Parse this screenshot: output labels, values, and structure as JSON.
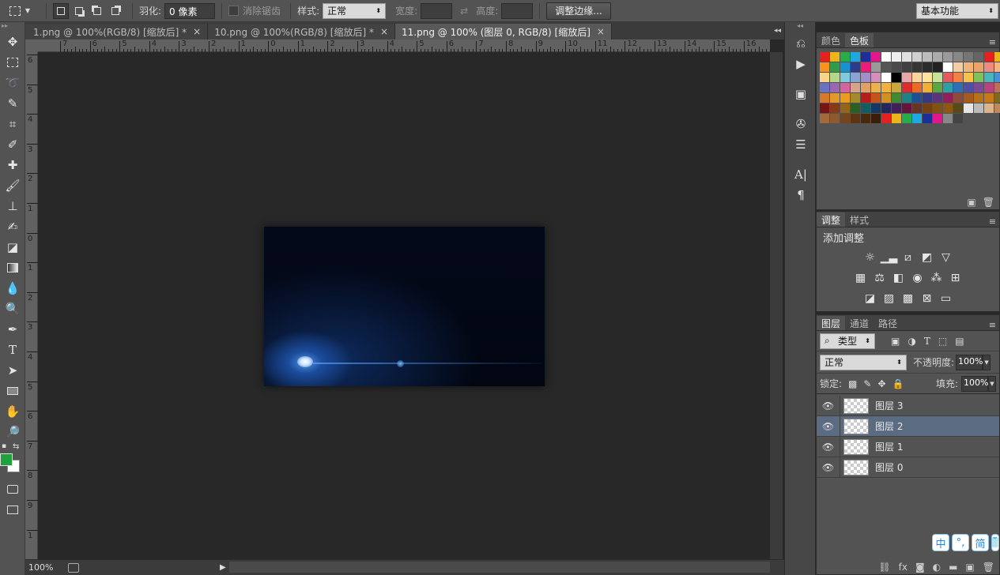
{
  "options_bar": {
    "feather_label": "羽化:",
    "feather_value": "0 像素",
    "antialias_label": "消除锯齿",
    "style_label": "样式:",
    "style_value": "正常",
    "width_label": "宽度:",
    "height_label": "高度:",
    "refine_edge_label": "调整边缘...",
    "workspace_value": "基本功能"
  },
  "tabs": [
    {
      "label": "1.png @ 100%(RGB/8) [缩放后] *"
    },
    {
      "label": "10.png @ 100%(RGB/8) [缩放后] *"
    },
    {
      "label": "11.png @ 100% (图层 0, RGB/8) [缩放后]"
    }
  ],
  "ruler": {
    "h_labels": [
      "7",
      "6",
      "5",
      "4",
      "3",
      "2",
      "1",
      "0",
      "1",
      "2",
      "3",
      "4",
      "5",
      "6",
      "7",
      "8",
      "9",
      "10",
      "11",
      "12",
      "13",
      "14",
      "15",
      "16"
    ],
    "v_labels": [
      "6",
      "5",
      "4",
      "3",
      "2",
      "1",
      "0",
      "1",
      "2",
      "3",
      "4",
      "5",
      "6",
      "7",
      "8",
      "9",
      "1",
      "0"
    ]
  },
  "status": {
    "zoom": "100%"
  },
  "swatches_panel": {
    "tabs": [
      "颜色",
      "色板"
    ],
    "colors": [
      "#e6201f",
      "#ebb51c",
      "#27ad47",
      "#1fa7e1",
      "#1c2f96",
      "#e4168c",
      "#ffffff",
      "#efefef",
      "#e0e0e0",
      "#cfcfcf",
      "#bdbdbd",
      "#ababab",
      "#9a9a9a",
      "#888888",
      "#767676",
      "#656565",
      "#e6201f",
      "#ebb51c",
      "#f7941d",
      "#2e9d4a",
      "#1891d1",
      "#2d3b8c",
      "#ed1c7a",
      "#9a9a9a",
      "#555555",
      "#4a4a4a",
      "#404040",
      "#363636",
      "#2c2c2c",
      "#222222",
      "#ffffff",
      "#f4cda4",
      "#efb47c",
      "#e8a368",
      "#ef8b7e",
      "#f6b482",
      "#fbd48a",
      "#b5d78c",
      "#7fcadb",
      "#8ba2d6",
      "#a18fc7",
      "#d38fb8",
      "#ffffff",
      "#000000",
      "#e9a6a6",
      "#ffd39b",
      "#ffe29b",
      "#c7e29b",
      "#e45b5b",
      "#f08246",
      "#f6c24c",
      "#7fc25d",
      "#4bb6b8",
      "#4b8fd4",
      "#6a72c3",
      "#9c67b2",
      "#d563a0",
      "#d9a28a",
      "#e3a064",
      "#e9b24c",
      "#f3b13b",
      "#c8a93c",
      "#dd2c2c",
      "#ea6a26",
      "#f0b033",
      "#5aa744",
      "#2ea0a4",
      "#2f6fb9",
      "#4e51a3",
      "#7b4a97",
      "#b9427e",
      "#bc6f57",
      "#d5792d",
      "#e1982c",
      "#eb9b20",
      "#a48a2c",
      "#b71c1c",
      "#c5531a",
      "#d1901f",
      "#3f8a33",
      "#1d8286",
      "#1d5193",
      "#353985",
      "#5c3479",
      "#921e5b",
      "#8f4b36",
      "#a65a1d",
      "#b4731b",
      "#c57a17",
      "#7b6a20",
      "#7a1313",
      "#893a12",
      "#93641a",
      "#2a6024",
      "#125d60",
      "#123966",
      "#24275e",
      "#421f58",
      "#65143f",
      "#663424",
      "#774013",
      "#815112",
      "#8e5610",
      "#574a17",
      "#e6e6e6",
      "#bbbbbb",
      "#dcb48c",
      "#be8a5c",
      "#a26a3c",
      "#8c5a2e",
      "#74441e",
      "#5c3414",
      "#4a280e",
      "#3a1e0a",
      "#e6201f",
      "#ebb51c",
      "#27ad47",
      "#1fa7e1",
      "#1c2f96",
      "#e4168c",
      "#888888",
      "#444444"
    ]
  },
  "adjust_panel": {
    "tabs": [
      "调整",
      "样式"
    ],
    "title": "添加调整"
  },
  "layers_panel": {
    "tabs": [
      "图层",
      "通道",
      "路径"
    ],
    "filter_kind": "类型",
    "blend_mode": "正常",
    "opacity_label": "不透明度:",
    "opacity_value": "100%",
    "lock_label": "锁定:",
    "fill_label": "填充:",
    "fill_value": "100%",
    "layers": [
      {
        "name": "图层 3",
        "selected": false
      },
      {
        "name": "图层 2",
        "selected": true
      },
      {
        "name": "图层 1",
        "selected": false
      },
      {
        "name": "图层 0",
        "selected": false
      }
    ]
  },
  "ime": {
    "buttons": [
      "中",
      "°,",
      "简"
    ]
  }
}
